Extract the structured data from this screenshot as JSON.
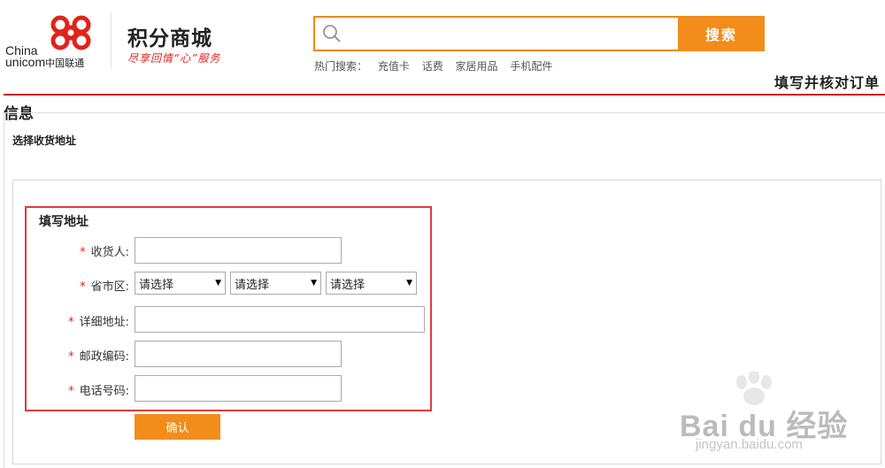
{
  "header": {
    "logo_line1": "China",
    "logo_line2": "unicom",
    "logo_cn": "中国联通",
    "site_title": "积分商城",
    "slogan": "尽享回情“心”服务",
    "search_button": "搜索",
    "search_placeholder": "",
    "hot_label": "热门搜索：",
    "hot_links": [
      "充值卡",
      "话费",
      "家居用品",
      "手机配件"
    ]
  },
  "step_title": "填写并核对订单",
  "info": {
    "title": "信息",
    "choose_address": "选择收货地址"
  },
  "form": {
    "title": "填写地址",
    "required_mark": "*",
    "receiver_label": "收货人:",
    "region_label": "省市区:",
    "region_selects": [
      "请选择",
      "请选择",
      "请选择"
    ],
    "detail_label": "详细地址:",
    "postcode_label": "邮政编码:",
    "phone_label": "电话号码:",
    "confirm_button": "确认"
  },
  "watermark": {
    "brand": "Bai du 经验",
    "url": "jingyan.baidu.com"
  },
  "colors": {
    "accent_orange": "#f28c1a",
    "brand_red": "#e2231a",
    "highlight_red": "#e03a3a"
  }
}
